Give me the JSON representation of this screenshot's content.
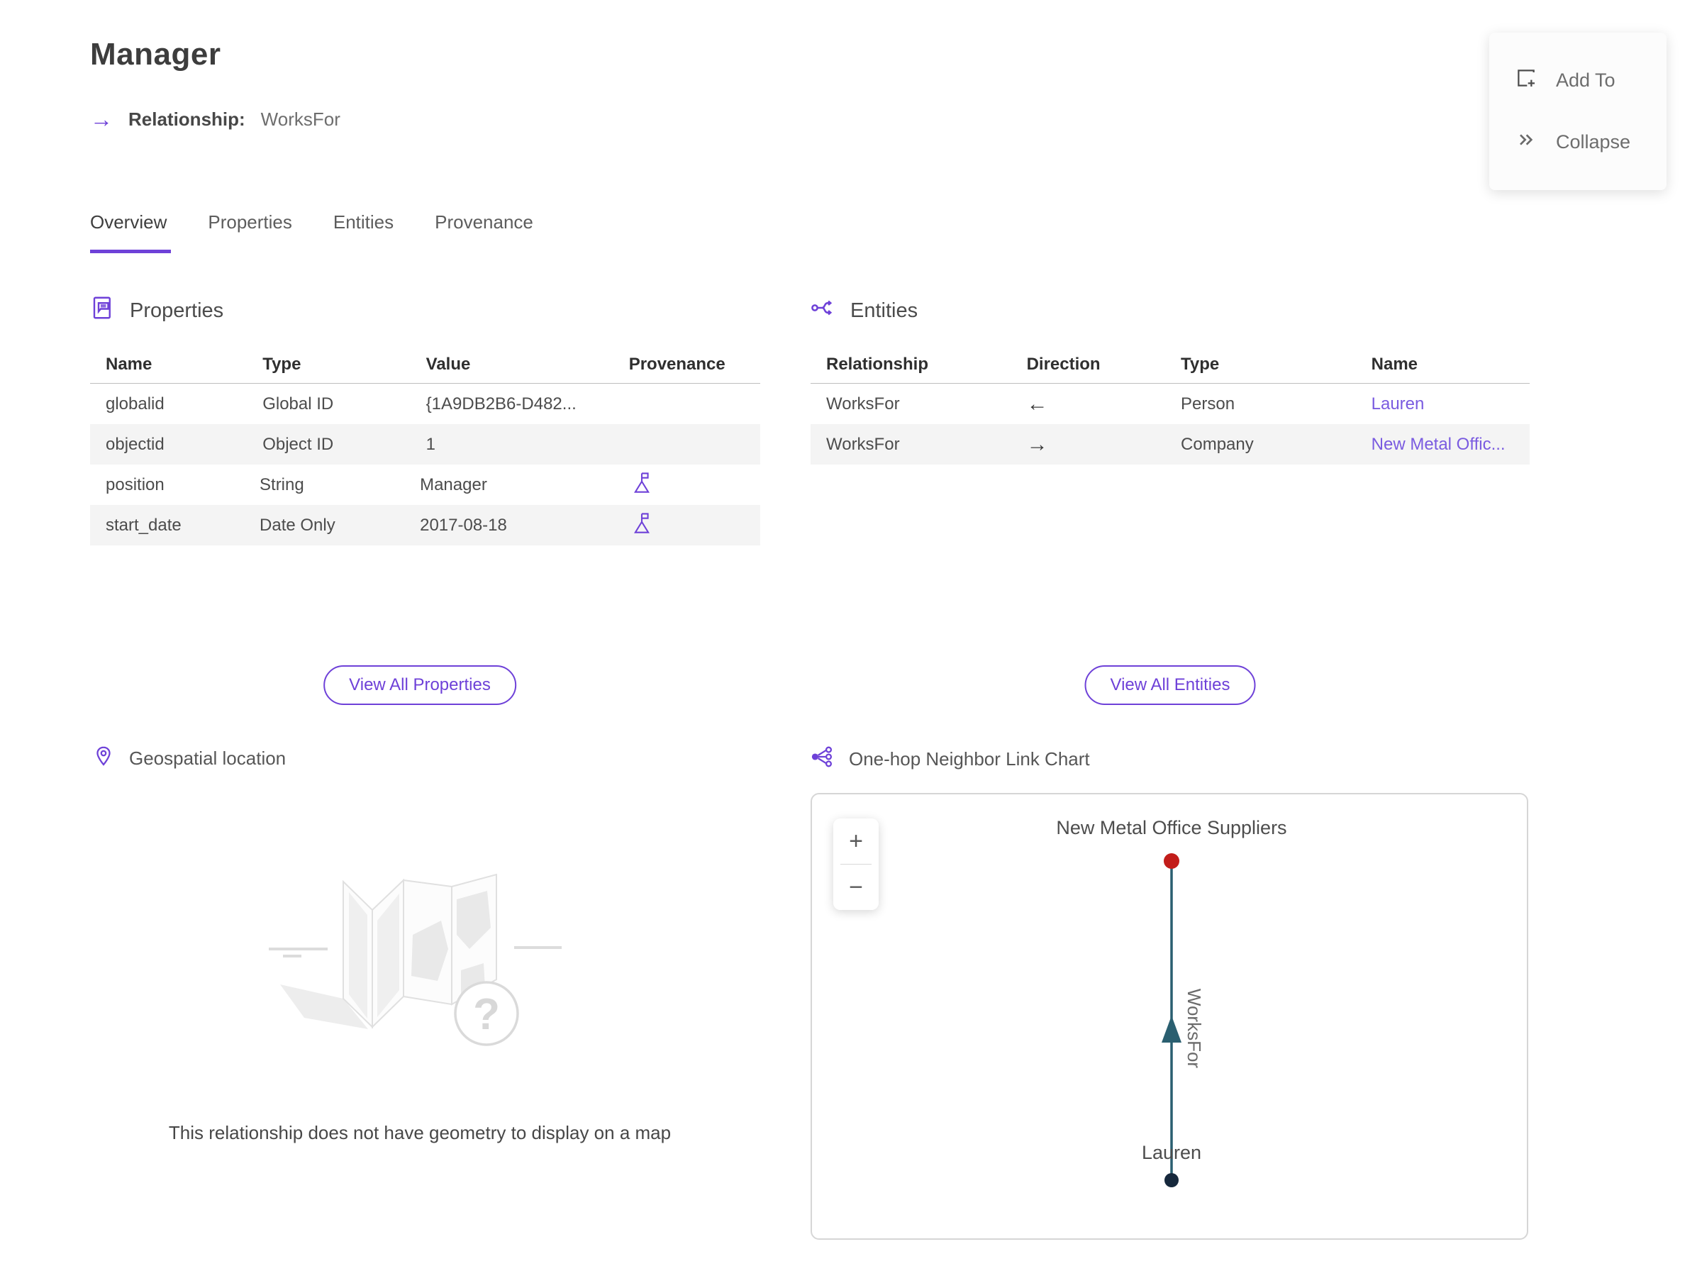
{
  "page": {
    "title": "Manager",
    "subtitle_label": "Relationship:",
    "subtitle_value": "WorksFor"
  },
  "actions": {
    "add_to": "Add To",
    "collapse": "Collapse"
  },
  "tabs": [
    {
      "label": "Overview",
      "active": true
    },
    {
      "label": "Properties",
      "active": false
    },
    {
      "label": "Entities",
      "active": false
    },
    {
      "label": "Provenance",
      "active": false
    }
  ],
  "properties_panel": {
    "title": "Properties",
    "columns": [
      "Name",
      "Type",
      "Value",
      "Provenance"
    ],
    "rows": [
      {
        "name": "globalid",
        "type": "Global ID",
        "value": "{1A9DB2B6-D482...",
        "provenance": false
      },
      {
        "name": "objectid",
        "type": "Object ID",
        "value": "1",
        "provenance": false
      },
      {
        "name": "position",
        "type": "String",
        "value": "Manager",
        "provenance": true
      },
      {
        "name": "start_date",
        "type": "Date Only",
        "value": "2017-08-18",
        "provenance": true
      }
    ],
    "view_all_label": "View All Properties"
  },
  "entities_panel": {
    "title": "Entities",
    "columns": [
      "Relationship",
      "Direction",
      "Type",
      "Name"
    ],
    "rows": [
      {
        "relationship": "WorksFor",
        "direction": "←",
        "type": "Person",
        "name": "Lauren"
      },
      {
        "relationship": "WorksFor",
        "direction": "→",
        "type": "Company",
        "name": "New Metal Offic..."
      }
    ],
    "view_all_label": "View All Entities"
  },
  "geospatial": {
    "title": "Geospatial location",
    "empty_message": "This relationship does not have geometry to display on a map"
  },
  "link_chart": {
    "title": "One-hop Neighbor Link Chart",
    "zoom_in": "+",
    "zoom_out": "−",
    "top_node": {
      "label": "New Metal Office Suppliers",
      "color": "#c21d1a"
    },
    "bottom_node": {
      "label": "Lauren",
      "color": "#16283c"
    },
    "edge": {
      "label": "WorksFor",
      "color": "#2a5f70"
    }
  },
  "colors": {
    "accent_purple": "#6e41d8",
    "link_purple": "#7a5be0",
    "row_stripe": "#f4f4f4"
  }
}
